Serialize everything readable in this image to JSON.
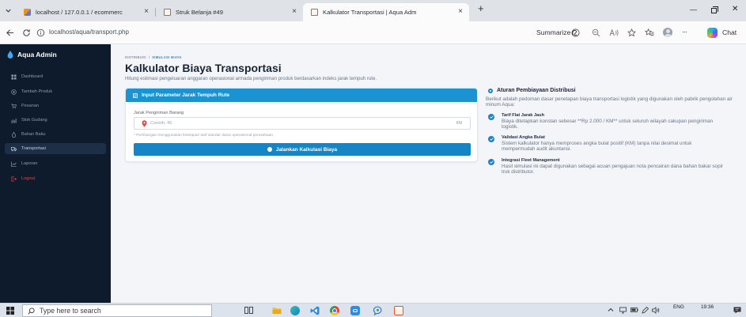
{
  "browser": {
    "tabs": [
      {
        "label": "localhost / 127.0.0.1 / ecommerc",
        "close": "×",
        "favicon": "phpmyadmin-icon"
      },
      {
        "label": "Struk Belanja #49",
        "close": "×",
        "favicon": "page-icon"
      },
      {
        "label": "Kalkulator Transportasi | Aqua Adm",
        "close": "×",
        "favicon": "page-icon",
        "active": true
      }
    ],
    "new_tab": "+",
    "window": {
      "minimize": "—",
      "close": "✕"
    },
    "address": "localhost/aqua/transport.php",
    "summarize": "Summarize",
    "more": "···",
    "chat": "Chat"
  },
  "sidebar": {
    "brand": "Aqua Admin",
    "items": [
      {
        "label": "Dashboard",
        "icon": "grid-icon"
      },
      {
        "label": "Tambah Produk",
        "icon": "plus-circle-icon"
      },
      {
        "label": "Pesanan",
        "icon": "cart-icon"
      },
      {
        "label": "Stok Gudang",
        "icon": "warehouse-icon"
      },
      {
        "label": "Bahan Baku",
        "icon": "drop-icon"
      },
      {
        "label": "Transportasi",
        "icon": "truck-icon",
        "active": true
      },
      {
        "label": "Laporan",
        "icon": "chart-line-icon"
      },
      {
        "label": "Logout",
        "icon": "logout-icon"
      }
    ]
  },
  "main": {
    "breadcrumb": {
      "parent": "DISTRIBUSI",
      "separator": "/",
      "current": "SIMULASI BIAYA"
    },
    "title": "Kalkulator Biaya Transportasi",
    "subtitle": "Hitung estimasi pengeluaran anggaran operasional armada pengiriman produk berdasarkan indeks jarak tempuh rute.",
    "card": {
      "header": "Input Parameter Jarak Tempuh Rute",
      "label": "Jarak Pengiriman Barang",
      "placeholder": "Contoh: 45",
      "unit": "KM",
      "note": "* Perhitungan menggunakan ketetapan tarif standar dasar operasional perusahaan",
      "button": "Jalankan Kalkulasi Biaya"
    }
  },
  "rules": {
    "title": "Aturan Pembiayaan Distribusi",
    "description": "Berikut adalah pedoman dasar penetapan biaya transportasi logistik yang digunakan oleh pabrik pengolahan air minum Aqua:",
    "items": [
      {
        "title": "Tarif Flat Jarak Jauh",
        "text": "Biaya ditetapkan konstan sebesar **Rp 2.000 / KM** untuk seluruh wilayah cakupan pengiriman logistik."
      },
      {
        "title": "Validasi Angka Bulat",
        "text": "Sistem kalkulator hanya memproses angka bulat positif (KM) tanpa nilai desimal untuk mempermudah audit akuntansi."
      },
      {
        "title": "Integrasi Fleet Management",
        "text": "Hasil simulasi ini dapat digunakan sebagai acuan pengajuan nota pencairan dana bahan bakar sopir truk distributor."
      }
    ]
  },
  "taskbar": {
    "search_placeholder": "Type here to search",
    "language": "ENG",
    "time": "19:36"
  },
  "colors": {
    "sidebar_bg": "#0e1b2d",
    "accent": "#1b92d2",
    "button": "#1685c6",
    "logout": "#e2463f",
    "main_bg": "#f3f5f8"
  }
}
